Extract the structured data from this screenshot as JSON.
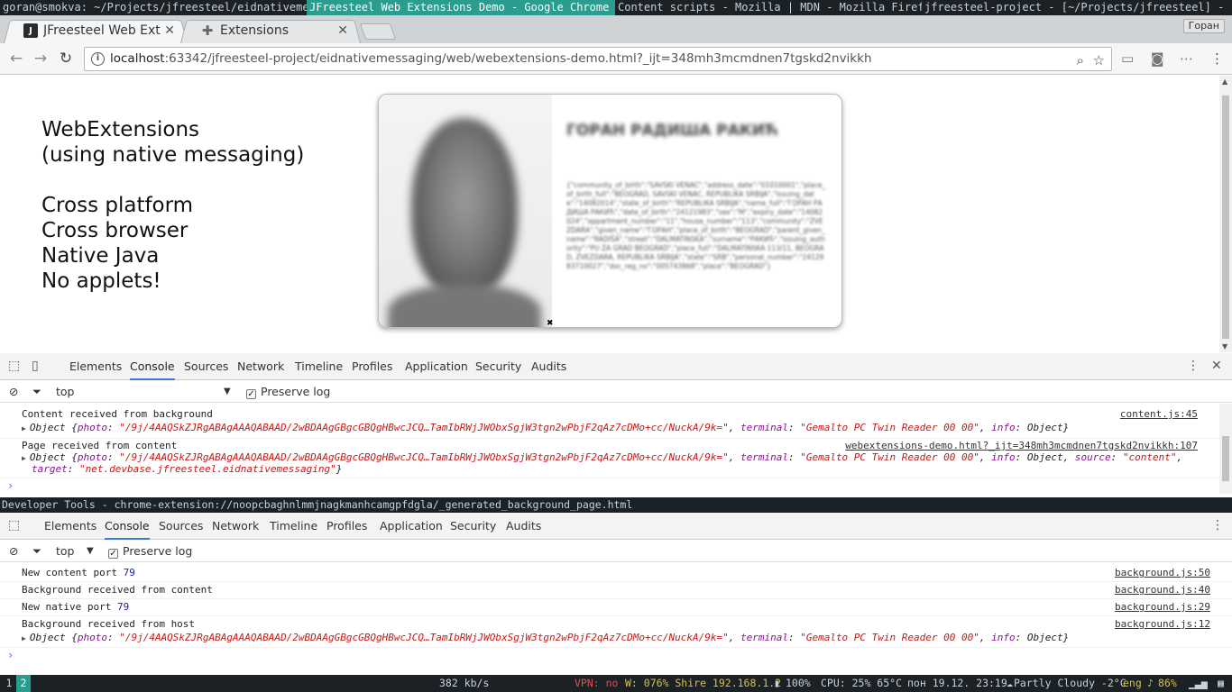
{
  "wm": {
    "titles": [
      "goran@smokva: ~/Projects/jfreesteel/eidnativemessaging",
      "JFreesteel Web Extensions Demo - Google Chrome",
      "Content scripts - Mozilla | MDN - Mozilla Firefox",
      "jfreesteel-project - [~/Projects/jfreesteel] - [eidnat..."
    ]
  },
  "tabs": [
    {
      "title": "JFreesteel Web Ext",
      "favicon": "J"
    },
    {
      "title": "Extensions",
      "favicon": "puzzle-icon"
    }
  ],
  "user_badge": "Горан",
  "omnibox": {
    "host": "localhost",
    "rest": ":63342/jfreesteel-project/eidnativemessaging/web/webextensions-demo.html?_ijt=348mh3mcmdnen7tgskd2nvikkh"
  },
  "hero": {
    "lines": [
      "WebExtensions",
      "(using native messaging)",
      "",
      "Cross platform",
      "Cross browser",
      "Native Java",
      "No applets!"
    ]
  },
  "card": {
    "name": "ГОРАН РАДИША РАКИЋ",
    "json": "{\"community_of_birth\":\"SAVSKI VENAC\",\"address_date\":\"01010001\",\"place_of_birth_full\":\"BEOGRAD, SAVSKI VENAC, REPUBLIKA SRBIJA\",\"issuing_date\":\"14082014\",\"state_of_birth\":\"REPUBLIKA SRBIJA\",\"name_full\":\"ГОРАН РАДИША РАКИЋ\",\"date_of_birth\":\"24121983\",\"sex\":\"M\",\"expiry_date\":\"14082024\",\"appartment_number\":\"11\",\"house_number\":\"113\",\"community\":\"ZVEZDARA\",\"given_name\":\"ГОРАН\",\"place_of_birth\":\"BEOGRAD\",\"parent_given_name\":\"RADIŠA\",\"street\":\"DALMATINSKA\",\"surname\":\"РАКИЋ\",\"issuing_authority\":\"PU ZA GRAD BEOGRAD\",\"place_full\":\"DALMATINSKA 113/11, BEOGRAD, ZVEZDARA, REPUBLIKA SRBIJA\",\"state\":\"SRB\",\"personal_number\":\"2412983710027\",\"doc_reg_no\":\"005743868\",\"place\":\"BEOGRAD\"}"
  },
  "devtools_tabs": [
    "Elements",
    "Console",
    "Sources",
    "Network",
    "Timeline",
    "Profiles",
    "Application",
    "Security",
    "Audits"
  ],
  "console1": {
    "context": "top",
    "preserve_log": "Preserve log",
    "rows": [
      {
        "msg": "Content received from background",
        "src": "content.js:45"
      },
      {
        "msg": "Page received from content",
        "src": "webextensions-demo.html?_ijt=348mh3mcmdnen7tgskd2nvikkh:107"
      }
    ],
    "obj_photo": "\"/9j/4AAQSkZJRgABAgAAAQABAAD/2wBDAAgGBgcGBQgHBwcJCQ…TamIbRWjJWObxSgjW3tgn2wPbjF2qAz7cDMo+cc/NuckA/9k=\"",
    "obj_terminal": "\"Gemalto PC Twin Reader 00 00\"",
    "obj_source": "\"content\"",
    "obj_target": "\"net.devbase.jfreesteel.eidnativemessaging\""
  },
  "devtools2_title": "Developer Tools - chrome-extension://noopcbaghnlmmjnagkmanhcamgpfdgla/_generated_background_page.html",
  "console2": {
    "context": "top",
    "preserve_log": "Preserve log",
    "rows": [
      {
        "msg": "New content port ",
        "num": "79",
        "src": "background.js:50"
      },
      {
        "msg": "Background received from content",
        "num": "",
        "src": "background.js:40"
      },
      {
        "msg": "New native port ",
        "num": "79",
        "src": "background.js:29"
      },
      {
        "msg": "Background received from host",
        "num": "",
        "src": "background.js:12"
      }
    ]
  },
  "obj_word": "Object",
  "statusbar": {
    "ws1": "1",
    "ws2": "2",
    "net": "382 kb/s",
    "vpn": "VPN: no",
    "wifi": "W: 076% Shire 192.168.1.2",
    "battery": "100%",
    "cpu": "CPU: 25% 65°C",
    "date": "пон 19.12. 23:19",
    "weather": "Partly Cloudy -2°C",
    "lang": "eng",
    "volume": "86%"
  },
  "colors": {
    "accent": "#2a9d8f",
    "link_key": "#881391",
    "string": "#c41a16",
    "number": "#1a1aa6"
  }
}
